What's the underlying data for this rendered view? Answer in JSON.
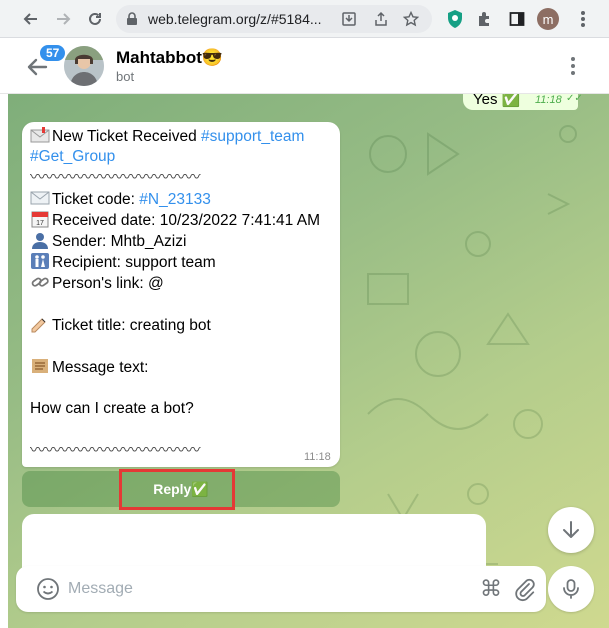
{
  "browser": {
    "url": "web.telegram.org/z/#5184...",
    "profile_initial": "m"
  },
  "header": {
    "unread_count": "57",
    "chat_name": "Mahtabbot😎",
    "chat_status": "bot"
  },
  "messages": {
    "outgoing": {
      "text": "Yes ✅",
      "time": "11:18"
    },
    "incoming": {
      "line1_text": "New Ticket Received ",
      "line1_tag": "#support_team",
      "line2_tag": "#Get_Group",
      "divider": "〰〰〰〰〰〰〰〰〰〰〰",
      "ticket_code_label": "Ticket code: ",
      "ticket_code_value": "#N_23133",
      "received_date": "Received date: 10/23/2022 7:41:41 AM",
      "sender": "Sender: Mhtb_Azizi",
      "recipient": "Recipient: support team",
      "person_link": "Person's link: @",
      "ticket_title": "Ticket title: creating bot",
      "message_text_label": "Message text:",
      "message_body": "How can I create a bot?",
      "divider_bottom": "〰〰〰〰〰〰〰〰〰〰〰",
      "time": "11:18"
    },
    "inline_button": {
      "label": "Reply✅"
    }
  },
  "composer": {
    "placeholder": "Message"
  },
  "colors": {
    "accent": "#3390ec",
    "highlight": "#e53935",
    "outgoing_bubble": "#eeffde"
  }
}
